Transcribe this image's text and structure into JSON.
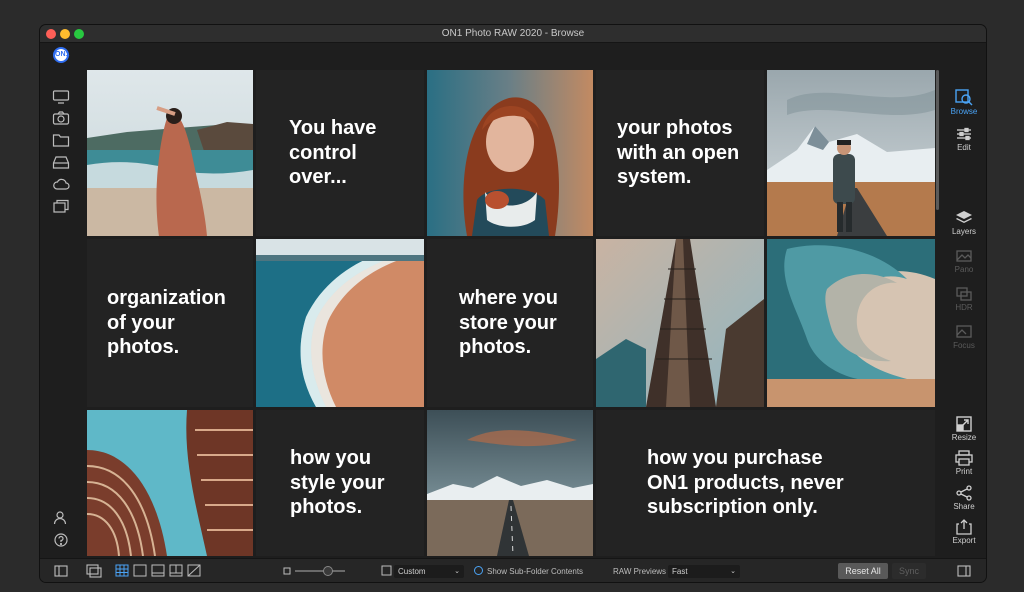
{
  "window": {
    "title": "ON1 Photo RAW 2020 - Browse"
  },
  "app_logo": "ON1",
  "left_sidebar": {
    "icons": [
      "monitor-icon",
      "camera-icon",
      "folder-icon",
      "drive-icon",
      "cloud-icon",
      "albums-icon"
    ],
    "bottom_icons": [
      "user-icon",
      "help-icon"
    ]
  },
  "grid": {
    "text_tiles": [
      {
        "text": "You have\ncontrol\nover..."
      },
      {
        "text": "your photos\nwith an open\nsystem."
      },
      {
        "text": "organization\nof your\nphotos."
      },
      {
        "text": "where you\nstore your\nphotos."
      },
      {
        "text": "how you\nstyle your\nphotos."
      },
      {
        "text": "how you purchase\nON1 products, never\nsubscription only."
      }
    ],
    "photos": [
      "woman-on-beach-photo",
      "red-haired-woman-portrait-photo",
      "man-on-mountain-road-photo",
      "aerial-beach-waves-photo",
      "skyscraper-photo",
      "wave-curl-photo",
      "curved-building-photo",
      "desert-road-mountains-photo"
    ]
  },
  "right_sidebar": {
    "modules": [
      {
        "label": "Browse",
        "icon": "browse-icon",
        "state": "active"
      },
      {
        "label": "Edit",
        "icon": "sliders-icon",
        "state": "normal"
      },
      {
        "label": "Layers",
        "icon": "layers-icon",
        "state": "normal"
      },
      {
        "label": "Pano",
        "icon": "pano-icon",
        "state": "dim"
      },
      {
        "label": "HDR",
        "icon": "hdr-icon",
        "state": "dim"
      },
      {
        "label": "Focus",
        "icon": "focus-icon",
        "state": "dim"
      },
      {
        "label": "Resize",
        "icon": "resize-icon",
        "state": "normal"
      },
      {
        "label": "Print",
        "icon": "print-icon",
        "state": "normal"
      },
      {
        "label": "Share",
        "icon": "share-icon",
        "state": "normal"
      },
      {
        "label": "Export",
        "icon": "export-icon",
        "state": "normal"
      }
    ]
  },
  "bottom_bar": {
    "thumbnail_size": "Custom",
    "show_subfolders_label": "Show Sub-Folder Contents",
    "raw_previews_label": "RAW Previews",
    "raw_previews_value": "Fast",
    "reset_all_label": "Reset All",
    "sync_label": "Sync",
    "view_modes": [
      "grid-view-icon",
      "detail-view-icon",
      "filmstrip-view-icon",
      "compare-view-icon",
      "map-view-icon"
    ]
  },
  "colors": {
    "accent": "#4aa3f5",
    "background": "#1e1e1e",
    "tile": "#232323"
  }
}
